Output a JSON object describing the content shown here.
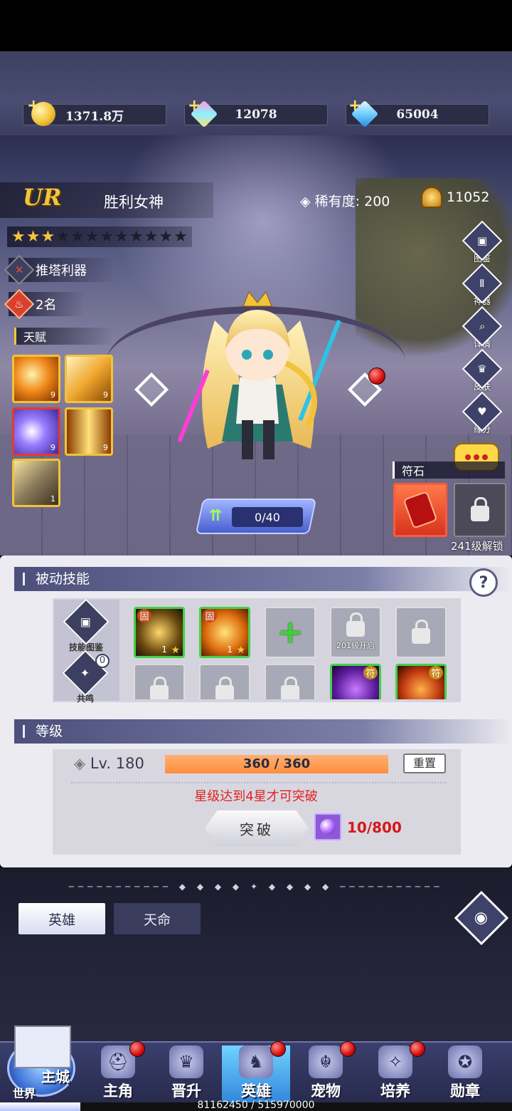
{
  "currency": {
    "gold": "1371.8万",
    "gems_pink": "12078",
    "gems_blue": "65004"
  },
  "hero": {
    "grade": "UR",
    "name": "胜利女神",
    "rarity_label": "稀有度:",
    "rarity_value": "200",
    "power": "11052",
    "stars_filled": 3,
    "stars_total": 12,
    "role_tag": "推塔利器",
    "rank_tag": "2名",
    "talent_label": "天赋",
    "talents": [
      {
        "level": "9",
        "icon": "claw-slash-icon"
      },
      {
        "level": "9",
        "icon": "blade-wind-icon"
      },
      {
        "level": "9",
        "icon": "vortex-icon"
      },
      {
        "level": "9",
        "icon": "light-pillar-icon"
      },
      {
        "level": "1",
        "icon": "sword-strike-icon"
      }
    ],
    "xp_text": "0/40"
  },
  "side_buttons": [
    {
      "label": "图鉴",
      "icon": "book-icon"
    },
    {
      "label": "神器",
      "icon": "artifact-icon"
    },
    {
      "label": "详情",
      "icon": "magnifier-icon"
    },
    {
      "label": "皮肤",
      "icon": "skin-icon"
    },
    {
      "label": "缘分",
      "icon": "heart-icon"
    }
  ],
  "runes": {
    "label": "符石",
    "locked_text": "241级解锁"
  },
  "passive": {
    "title": "被动技能",
    "side": [
      {
        "label": "技能图鉴"
      },
      {
        "label": "共鸣",
        "badge": "0"
      }
    ],
    "slots_row1": [
      {
        "type": "skill",
        "level": "1",
        "tag": "固"
      },
      {
        "type": "skill",
        "level": "1",
        "tag": "固"
      },
      {
        "type": "add"
      },
      {
        "type": "locked",
        "text": "201级开启"
      },
      {
        "type": "locked"
      }
    ],
    "slots_row2": [
      {
        "type": "locked"
      },
      {
        "type": "locked"
      },
      {
        "type": "locked"
      },
      {
        "type": "skill",
        "tag": "符"
      },
      {
        "type": "skill",
        "tag": "符"
      }
    ]
  },
  "level": {
    "title": "等级",
    "lv_prefix": "Lv.",
    "lv_value": "180",
    "exp_text": "360 / 360",
    "exp_fraction": 1.0,
    "reset_label": "重置",
    "warning": "星级达到4星才可突破",
    "break_label": "突破",
    "orb_count": "10/800"
  },
  "bottom_tabs": {
    "hero": "英雄",
    "fate": "天命"
  },
  "nav": {
    "main_city": "主城",
    "world": "世界",
    "items": [
      {
        "label": "主角",
        "icon": "helmet-icon",
        "dot": true
      },
      {
        "label": "晋升",
        "icon": "crown-icon",
        "dot": false
      },
      {
        "label": "英雄",
        "icon": "knight-icon",
        "dot": true,
        "active": true
      },
      {
        "label": "宠物",
        "icon": "beast-icon",
        "dot": true
      },
      {
        "label": "培养",
        "icon": "compass-icon",
        "dot": true
      },
      {
        "label": "勋章",
        "icon": "medal-icon",
        "dot": false
      }
    ]
  },
  "progress": {
    "text": "81162450 / 515970000",
    "fraction": 0.157
  },
  "colors": {
    "accent_gold": "#f5c63b",
    "warning_red": "#e2221e",
    "exp_orange": "#ff8e3a"
  }
}
